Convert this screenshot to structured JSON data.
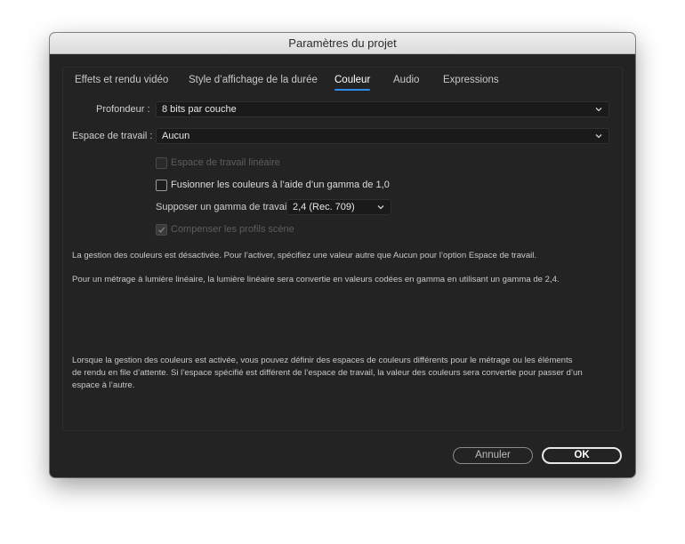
{
  "window": {
    "title": "Paramètres du projet"
  },
  "tabs": [
    {
      "label": "Effets et rendu vidéo",
      "active": false
    },
    {
      "label": "Style d’affichage de la durée",
      "active": false
    },
    {
      "label": "Couleur",
      "active": true
    },
    {
      "label": "Audio",
      "active": false
    },
    {
      "label": "Expressions",
      "active": false
    }
  ],
  "form": {
    "depth": {
      "label": "Profondeur :",
      "value": "8 bits par couche"
    },
    "working_space": {
      "label": "Espace de travail :",
      "value": "Aucun"
    },
    "linearize": {
      "label": "Espace de travail linéaire",
      "checked": false,
      "enabled": false
    },
    "blend_gamma": {
      "label": "Fusionner les couleurs à l’aide d’un gamma de 1,0",
      "checked": false,
      "enabled": true
    },
    "gamma": {
      "label": "Supposer un gamma de travail :",
      "value": "2,4 (Rec. 709)"
    },
    "compensate": {
      "label": "Compenser les profils scène",
      "checked": true,
      "enabled": false
    }
  },
  "info": {
    "line1": "La gestion des couleurs est désactivée. Pour l’activer, spécifiez une valeur autre que Aucun pour l’option Espace de travail.",
    "line2": "Pour un métrage à lumière linéaire, la lumière linéaire sera convertie en valeurs codées en gamma en utilisant un gamma de 2,4.",
    "footer_1": "Lorsque la gestion des couleurs est activée, vous pouvez définir des espaces de couleurs différents pour le métrage ou les éléments",
    "footer_2": "de rendu en file d’attente. Si l’espace spécifié est différent de l’espace de travail, la valeur des couleurs sera convertie pour passer d’un",
    "footer_3": "espace à l’autre."
  },
  "buttons": {
    "cancel": "Annuler",
    "ok": "OK"
  },
  "colors": {
    "background": "#232323",
    "accent": "#2d8ceb",
    "titlebar": "#e4e4e4"
  }
}
